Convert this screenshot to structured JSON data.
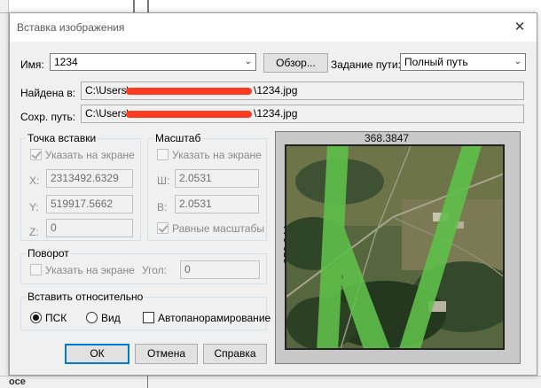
{
  "background": {
    "bottom_tab_text": "осе"
  },
  "dialog": {
    "title": "Вставка изображения",
    "close_glyph": "✕",
    "name_label": "Имя:",
    "name_value": "1234",
    "browse_label": "Обзор...",
    "path_type_label": "Задание пути:",
    "path_type_value": "Полный путь",
    "found_label": "Найдена в:",
    "found_prefix": "C:\\Users\\",
    "found_suffix": "\\1234.jpg",
    "saved_label": "Сохр. путь:",
    "saved_prefix": "C:\\Users\\",
    "saved_suffix": "\\1234.jpg"
  },
  "insert_point": {
    "title": "Точка вставки",
    "specify_on_screen": "Указать на экране",
    "x_label": "X:",
    "x_value": "2313492.6329",
    "y_label": "Y:",
    "y_value": "519917.5662",
    "z_label": "Z:",
    "z_value": "0"
  },
  "scale": {
    "title": "Масштаб",
    "specify_on_screen": "Указать на экране",
    "w_label": "Ш:",
    "w_value": "2.0531",
    "h_label": "В:",
    "h_value": "2.0531",
    "uniform": "Равные масштабы"
  },
  "rotation": {
    "title": "Поворот",
    "specify_on_screen": "Указать на экране",
    "angle_label": "Угол:",
    "angle_value": "0"
  },
  "insert_relative": {
    "title": "Вставить относительно",
    "psk": "ПСК",
    "view": "Вид",
    "autopan": "Автопанорамирование"
  },
  "preview": {
    "width_value": "368.3847",
    "height_value": "352.044"
  },
  "buttons": {
    "ok": "ОК",
    "cancel": "Отмена",
    "help": "Справка"
  },
  "colors": {
    "accent": "#0078d7",
    "redaction": "#ff3b22",
    "overlay_green": "#5fbf4a"
  }
}
